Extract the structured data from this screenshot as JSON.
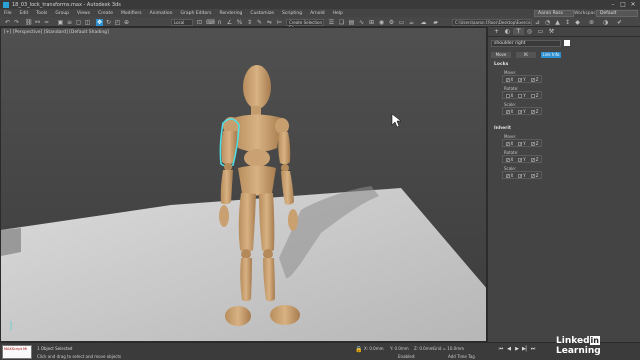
{
  "window": {
    "title": "18_03_lock_transforms.max - Autodesk 3ds",
    "controls": [
      "–",
      "□",
      "✕"
    ]
  },
  "menu": {
    "items": [
      "File",
      "Edit",
      "Tools",
      "Group",
      "Views",
      "Create",
      "Modifiers",
      "Animation",
      "Graph Editors",
      "Rendering",
      "Customize",
      "Scripting",
      "Arnold",
      "Help"
    ],
    "user": "Aaron Ross",
    "workspaces_label": "Workspaces:",
    "workspace": "Default"
  },
  "toolbar": {
    "coord_system": "Local",
    "selection_set": "Create Selection Se",
    "project_path": "C:\\Users\\aaron.f.Ross\\Desktop\\Exercise_Files"
  },
  "viewport": {
    "label": "[+] [Perspective] [Standard] [Default Shading]"
  },
  "panel": {
    "object_name": "shoulder right",
    "sub_tabs": [
      "Move",
      "IK",
      "Link Info"
    ],
    "locks": {
      "title": "Locks",
      "move_label": "Move:",
      "rotate_label": "Rotate:",
      "scale_label": "Scale:",
      "move": [
        {
          "axis": "X",
          "on": true
        },
        {
          "axis": "Y",
          "on": true
        },
        {
          "axis": "Z",
          "on": true
        }
      ],
      "rotate": [
        {
          "axis": "X",
          "on": false
        },
        {
          "axis": "Y",
          "on": false
        },
        {
          "axis": "Z",
          "on": false
        }
      ],
      "scale": [
        {
          "axis": "X",
          "on": true
        },
        {
          "axis": "Y",
          "on": true
        },
        {
          "axis": "Z",
          "on": true
        }
      ]
    },
    "inherit": {
      "title": "Inherit",
      "move_label": "Move:",
      "rotate_label": "Rotate:",
      "scale_label": "Scale:",
      "move": [
        {
          "axis": "X",
          "on": true
        },
        {
          "axis": "Y",
          "on": true
        },
        {
          "axis": "Z",
          "on": true
        }
      ],
      "rotate": [
        {
          "axis": "X",
          "on": true
        },
        {
          "axis": "Y",
          "on": true
        },
        {
          "axis": "Z",
          "on": true
        }
      ],
      "scale": [
        {
          "axis": "X",
          "on": true
        },
        {
          "axis": "Y",
          "on": true
        },
        {
          "axis": "Z",
          "on": true
        }
      ]
    }
  },
  "status": {
    "maxscript": "MAXScript Mi",
    "selected": "1 Object Selected",
    "prompt": "Click and drag to select and move objects",
    "x": "0.0mm",
    "y": "0.0mm",
    "z": "0.0mm",
    "grid": "Grid = 10.0mm",
    "enabled": "Enabled:",
    "add_time_tag": "Add Time Tag"
  },
  "watermark": {
    "linked": "Linked",
    "in": "in",
    "learning": "Learning"
  },
  "colors": {
    "accent": "#2b8fd0",
    "selection_outline": "#4ee0e8"
  }
}
